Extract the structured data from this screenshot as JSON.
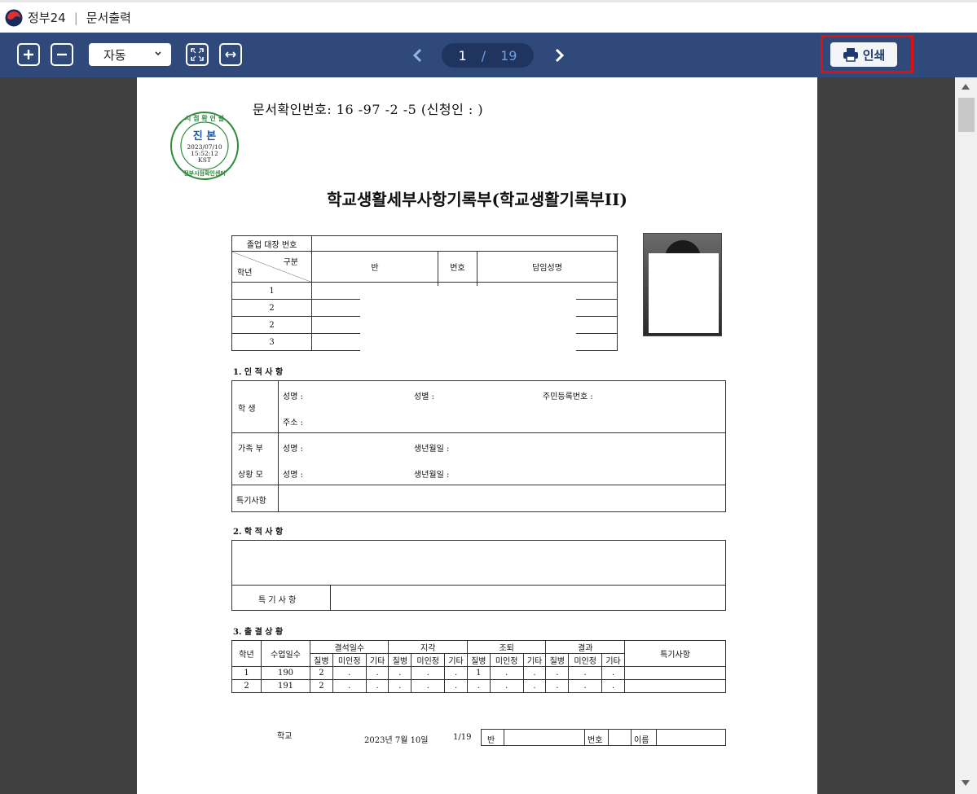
{
  "titlebar": {
    "app_name": "정부24",
    "window_title": "문서출력"
  },
  "toolbar": {
    "zoom_in_icon": "plus-box-icon",
    "zoom_out_icon": "minus-box-icon",
    "zoom_select_value": "자동",
    "page_current": "1",
    "page_separator": "/",
    "page_total": "19",
    "print_label": "인쇄"
  },
  "document": {
    "doc_number_line": "문서확인번호: 16     -97     -2       -5      (신청인 :           )",
    "seal": {
      "top_text": "시 점 확 인 필",
      "center": "진 본",
      "date": "2023/07/10",
      "time": "15:52:12",
      "tz": "KST",
      "bottom_text": "정부시점확인센터"
    },
    "title": "학교생활세부사항기록부(학교생활기록부II)",
    "table1": {
      "row0_label": "졸업 대장 번호",
      "diag_top": "구분",
      "diag_bottom": "학년",
      "col_class": "반",
      "col_number": "번호",
      "col_teacher": "담임성명",
      "grades": [
        "1",
        "2",
        "2",
        "3"
      ]
    },
    "sec1": {
      "heading": "1. 인 적 사 항",
      "student_label": "학    생",
      "name": "성명 :",
      "gender": "성별 :",
      "rrn": "주민등록번호 :",
      "address": "주소 :",
      "family_top": "가족  부",
      "family_bottom": "상황  모",
      "father_name": "성명 :",
      "mother_name": "성명 :",
      "birth1": "생년월일 :",
      "birth2": "생년월일 :",
      "special": "특기사항"
    },
    "sec2": {
      "heading": "2. 학 적 사 항",
      "special": "특 기 사 항"
    },
    "sec3": {
      "heading": "3. 출 결 상 황",
      "h_grade": "학년",
      "h_days": "수업일수",
      "groups": [
        "결석일수",
        "지각",
        "조퇴",
        "결과"
      ],
      "sub": [
        "질병",
        "미인정",
        "기타"
      ],
      "h_special": "특기사항",
      "rows": [
        {
          "grade": "1",
          "days": "190",
          "cells": [
            "2",
            ".",
            ".",
            ".",
            ".",
            ".",
            "1",
            ".",
            ".",
            ".",
            ".",
            "."
          ]
        },
        {
          "grade": "2",
          "days": "191",
          "cells": [
            "2",
            ".",
            ".",
            ".",
            ".",
            ".",
            ".",
            ".",
            ".",
            ".",
            ".",
            "."
          ]
        }
      ]
    },
    "footer": {
      "school": "학교",
      "date": "2023년 7월 10일",
      "page": "1/19",
      "class": "반",
      "number": "번호",
      "name": "이름"
    }
  }
}
